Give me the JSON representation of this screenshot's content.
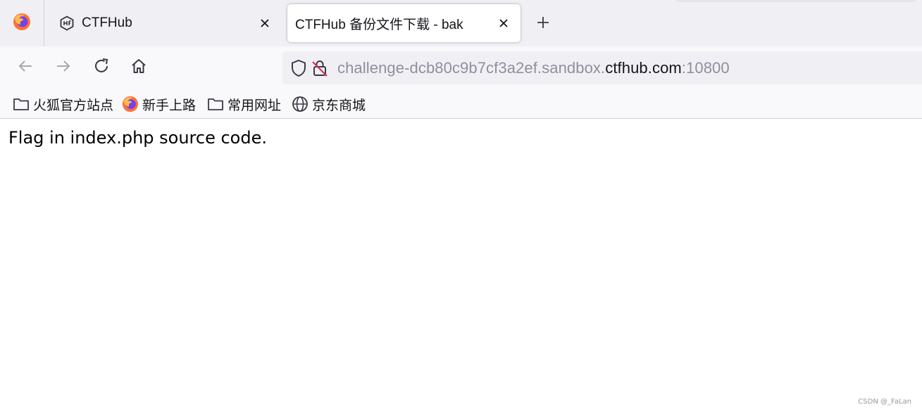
{
  "tabs": [
    {
      "title": "CTFHub",
      "active": false
    },
    {
      "title": "CTFHub 备份文件下载 - bak",
      "active": true
    }
  ],
  "url": {
    "prefix": "challenge-dcb80c9b7cf3a2ef.sandbox.",
    "domain": "ctfhub.com",
    "suffix": ":10800"
  },
  "bookmarks": [
    {
      "label": "火狐官方站点",
      "icon": "folder-icon"
    },
    {
      "label": "新手上路",
      "icon": "firefox-icon"
    },
    {
      "label": "常用网址",
      "icon": "folder-icon"
    },
    {
      "label": "京东商城",
      "icon": "globe-icon"
    }
  ],
  "page": {
    "text": "Flag in index.php source code."
  },
  "watermark": "CSDN @_FaLan",
  "colors": {
    "tab_strip": "#f0f0f4",
    "toolbar": "#f9f9fb",
    "url_dim": "#8f8f9d",
    "url_domain": "#15141a",
    "lock_strike": "#e22850"
  }
}
